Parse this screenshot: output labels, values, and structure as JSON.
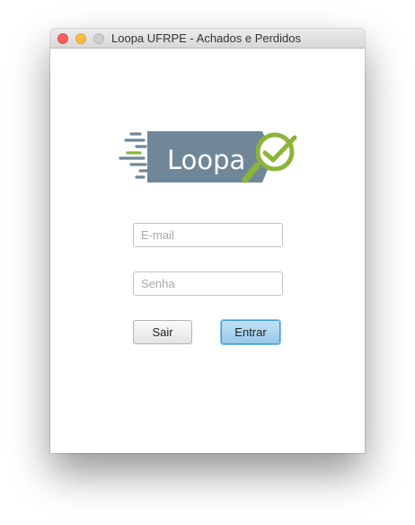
{
  "window": {
    "title": "Loopa UFRPE - Achados e Perdidos",
    "controls": [
      "close",
      "minimize",
      "zoom"
    ]
  },
  "logo": {
    "text": "Loopa",
    "icon": "magnifier-check-icon",
    "colors": {
      "banner": "#6f8799",
      "accent": "#8db43a",
      "text": "#ffffff"
    }
  },
  "form": {
    "email_placeholder": "E-mail",
    "password_placeholder": "Senha",
    "email_value": "",
    "password_value": ""
  },
  "buttons": {
    "exit_label": "Sair",
    "enter_label": "Entrar"
  }
}
